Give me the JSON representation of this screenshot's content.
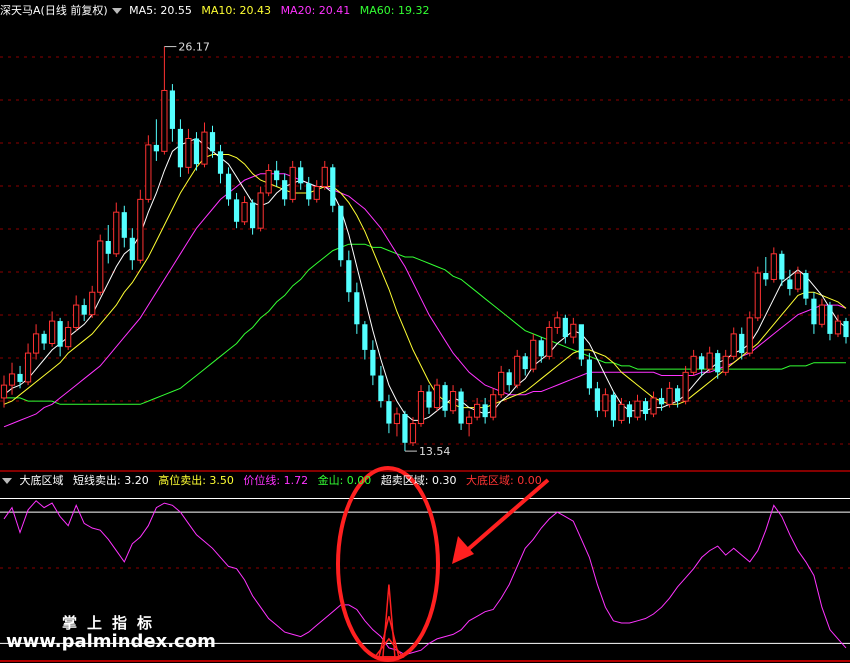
{
  "header": {
    "security": "深天马A",
    "period": "(日线 前复权)",
    "ma": [
      {
        "label": "MA5: 20.55",
        "color": "#ffffff"
      },
      {
        "label": "MA10: 20.43",
        "color": "#ffff33"
      },
      {
        "label": "MA20: 20.41",
        "color": "#ff33ff"
      },
      {
        "label": "MA60: 19.32",
        "color": "#33ff33"
      }
    ]
  },
  "indicator": {
    "name": "大底区域",
    "items": [
      {
        "label": "短线卖出: 3.20",
        "color": "#ffffff"
      },
      {
        "label": "高位卖出: 3.50",
        "color": "#ffff33"
      },
      {
        "label": "价位线: 1.72",
        "color": "#ff33ff"
      },
      {
        "label": "金山: 0.00",
        "color": "#33ff33"
      },
      {
        "label": "超卖区域: 0.30",
        "color": "#ffffff"
      },
      {
        "label": "大底区域: 0.00",
        "color": "#ff3333"
      }
    ]
  },
  "annotations": {
    "high": "26.17",
    "low": "13.54"
  },
  "watermark": {
    "line1": "掌上指标",
    "line2": "www.palmindex.com"
  },
  "colors": {
    "up": "#ff3232",
    "down": "#54ffff",
    "ma5": "#ffffff",
    "ma10": "#ffff33",
    "ma20": "#ff33ff",
    "ma60": "#33ff33",
    "grid": "#8b0000",
    "indicator": "#ff33ff",
    "spike": "#ff2020",
    "circle": "#ff2020"
  },
  "chart_data": {
    "type": "candlestick",
    "price_range": [
      13.2,
      27.0
    ],
    "candles": [
      [
        15.2,
        15.9,
        14.9,
        15.6
      ],
      [
        15.6,
        16.3,
        15.3,
        15.95
      ],
      [
        15.95,
        16.2,
        15.5,
        15.7
      ],
      [
        15.7,
        16.9,
        15.6,
        16.6
      ],
      [
        16.6,
        17.5,
        16.4,
        17.2
      ],
      [
        17.2,
        17.3,
        16.7,
        16.9
      ],
      [
        16.9,
        17.9,
        16.8,
        17.6
      ],
      [
        17.6,
        17.7,
        16.5,
        16.8
      ],
      [
        16.8,
        17.6,
        16.7,
        17.4
      ],
      [
        17.4,
        18.4,
        17.3,
        18.1
      ],
      [
        18.1,
        18.3,
        17.6,
        17.8
      ],
      [
        17.8,
        18.7,
        17.7,
        18.5
      ],
      [
        18.5,
        20.3,
        18.4,
        20.1
      ],
      [
        20.1,
        20.6,
        19.4,
        19.7
      ],
      [
        19.7,
        21.3,
        19.6,
        21.0
      ],
      [
        21.0,
        21.2,
        19.9,
        20.2
      ],
      [
        20.2,
        20.5,
        19.2,
        19.5
      ],
      [
        19.5,
        21.7,
        19.4,
        21.4
      ],
      [
        21.4,
        23.4,
        21.3,
        23.1
      ],
      [
        23.1,
        23.9,
        22.6,
        22.9
      ],
      [
        22.9,
        26.17,
        22.8,
        24.8
      ],
      [
        24.8,
        25.0,
        23.2,
        23.6
      ],
      [
        23.6,
        23.9,
        22.1,
        22.4
      ],
      [
        22.4,
        23.6,
        22.2,
        23.3
      ],
      [
        23.3,
        23.5,
        22.3,
        22.5
      ],
      [
        22.5,
        23.8,
        22.4,
        23.5
      ],
      [
        23.5,
        23.7,
        22.7,
        22.9
      ],
      [
        22.9,
        23.1,
        21.9,
        22.2
      ],
      [
        22.2,
        22.4,
        21.2,
        21.4
      ],
      [
        21.4,
        21.6,
        20.5,
        20.7
      ],
      [
        20.7,
        21.5,
        20.6,
        21.3
      ],
      [
        21.3,
        21.4,
        20.3,
        20.5
      ],
      [
        20.5,
        21.8,
        20.4,
        21.6
      ],
      [
        21.6,
        22.5,
        21.5,
        22.3
      ],
      [
        22.3,
        22.6,
        21.8,
        22.0
      ],
      [
        22.0,
        22.2,
        21.2,
        21.4
      ],
      [
        21.4,
        22.6,
        21.3,
        22.4
      ],
      [
        22.4,
        22.6,
        21.7,
        21.9
      ],
      [
        21.9,
        22.1,
        21.2,
        21.4
      ],
      [
        21.4,
        22.0,
        21.3,
        21.8
      ],
      [
        21.8,
        22.6,
        21.7,
        22.4
      ],
      [
        22.4,
        22.5,
        21.0,
        21.2
      ],
      [
        21.2,
        20.8,
        19.3,
        19.5
      ],
      [
        19.5,
        19.8,
        18.2,
        18.5
      ],
      [
        18.5,
        18.8,
        17.2,
        17.5
      ],
      [
        17.5,
        17.6,
        16.4,
        16.7
      ],
      [
        16.7,
        17.0,
        15.6,
        15.9
      ],
      [
        15.9,
        16.2,
        14.9,
        15.1
      ],
      [
        15.1,
        15.3,
        14.1,
        14.4
      ],
      [
        14.4,
        14.9,
        14.0,
        14.7
      ],
      [
        14.7,
        14.8,
        13.54,
        13.8
      ],
      [
        13.8,
        14.6,
        13.7,
        14.4
      ],
      [
        14.4,
        15.6,
        14.3,
        15.4
      ],
      [
        15.4,
        15.6,
        14.7,
        14.9
      ],
      [
        14.9,
        15.8,
        14.8,
        15.6
      ],
      [
        15.6,
        15.7,
        14.6,
        14.8
      ],
      [
        14.8,
        15.6,
        14.7,
        15.4
      ],
      [
        15.4,
        15.5,
        14.2,
        14.4
      ],
      [
        14.4,
        14.8,
        14.0,
        14.6
      ],
      [
        14.6,
        15.2,
        14.5,
        15.0
      ],
      [
        15.0,
        15.2,
        14.4,
        14.6
      ],
      [
        14.6,
        15.5,
        14.5,
        15.3
      ],
      [
        15.3,
        16.2,
        15.2,
        16.0
      ],
      [
        16.0,
        16.1,
        15.4,
        15.6
      ],
      [
        15.6,
        16.7,
        15.5,
        16.5
      ],
      [
        16.5,
        16.6,
        15.9,
        16.1
      ],
      [
        16.1,
        17.2,
        16.0,
        17.0
      ],
      [
        17.0,
        17.1,
        16.3,
        16.5
      ],
      [
        16.5,
        17.6,
        16.4,
        17.4
      ],
      [
        17.4,
        17.9,
        17.2,
        17.7
      ],
      [
        17.7,
        17.8,
        16.9,
        17.1
      ],
      [
        17.1,
        17.7,
        16.9,
        17.5
      ],
      [
        17.5,
        17.2,
        16.2,
        16.4
      ],
      [
        16.4,
        16.6,
        15.3,
        15.5
      ],
      [
        15.5,
        15.7,
        14.6,
        14.8
      ],
      [
        14.8,
        15.5,
        14.6,
        15.3
      ],
      [
        15.3,
        15.4,
        14.3,
        14.5
      ],
      [
        14.5,
        15.2,
        14.4,
        15.0
      ],
      [
        15.0,
        15.1,
        14.4,
        14.6
      ],
      [
        14.6,
        15.3,
        14.5,
        15.1
      ],
      [
        15.1,
        15.2,
        14.5,
        14.7
      ],
      [
        14.7,
        15.4,
        14.6,
        15.2
      ],
      [
        15.2,
        15.5,
        14.8,
        15.0
      ],
      [
        15.0,
        15.7,
        14.9,
        15.5
      ],
      [
        15.5,
        15.6,
        14.9,
        15.1
      ],
      [
        15.1,
        16.2,
        15.0,
        16.0
      ],
      [
        16.0,
        16.7,
        15.9,
        16.5
      ],
      [
        16.5,
        16.6,
        15.9,
        16.1
      ],
      [
        16.1,
        16.8,
        16.0,
        16.6
      ],
      [
        16.6,
        16.7,
        15.8,
        16.0
      ],
      [
        16.0,
        16.7,
        15.9,
        16.5
      ],
      [
        16.5,
        17.4,
        16.4,
        17.2
      ],
      [
        17.2,
        17.4,
        16.4,
        16.6
      ],
      [
        16.6,
        17.9,
        16.5,
        17.7
      ],
      [
        17.7,
        19.3,
        17.6,
        19.1
      ],
      [
        19.1,
        19.6,
        18.7,
        18.9
      ],
      [
        18.9,
        19.9,
        18.8,
        19.7
      ],
      [
        19.7,
        19.8,
        18.7,
        18.9
      ],
      [
        18.9,
        19.2,
        18.4,
        18.6
      ],
      [
        18.6,
        19.3,
        18.5,
        19.1
      ],
      [
        19.1,
        19.2,
        18.1,
        18.3
      ],
      [
        18.3,
        18.5,
        17.2,
        17.5
      ],
      [
        17.5,
        18.3,
        17.4,
        18.1
      ],
      [
        18.1,
        18.2,
        17.0,
        17.2
      ],
      [
        17.2,
        17.8,
        17.1,
        17.6
      ],
      [
        17.6,
        17.7,
        16.9,
        17.1
      ]
    ],
    "ma5": [
      15.3,
      15.5,
      15.6,
      15.8,
      16.1,
      16.4,
      16.7,
      16.9,
      17.1,
      17.3,
      17.5,
      17.8,
      18.3,
      18.8,
      19.3,
      19.7,
      19.9,
      20.3,
      21.0,
      21.6,
      22.3,
      22.9,
      23.1,
      23.2,
      23.3,
      23.1,
      22.9,
      22.7,
      22.5,
      22.1,
      21.7,
      21.3,
      21.2,
      21.3,
      21.6,
      21.8,
      21.9,
      22.0,
      21.9,
      21.8,
      21.8,
      21.6,
      21.1,
      20.3,
      19.3,
      18.3,
      17.3,
      16.4,
      15.6,
      15.1,
      14.7,
      14.5,
      14.5,
      14.6,
      14.8,
      15.0,
      15.2,
      15.1,
      14.9,
      14.8,
      14.7,
      14.8,
      15.1,
      15.3,
      15.6,
      15.8,
      16.2,
      16.4,
      16.6,
      16.9,
      17.1,
      17.3,
      17.2,
      16.9,
      16.4,
      15.9,
      15.4,
      15.0,
      14.8,
      14.8,
      14.8,
      14.9,
      14.9,
      15.0,
      15.1,
      15.3,
      15.6,
      15.9,
      16.1,
      16.3,
      16.4,
      16.6,
      16.7,
      16.9,
      17.3,
      17.8,
      18.3,
      18.8,
      19.0,
      19.2,
      19.0,
      18.7,
      18.4,
      18.0,
      17.6,
      17.4
    ],
    "ma10": [
      15.0,
      15.1,
      15.3,
      15.5,
      15.7,
      15.9,
      16.1,
      16.3,
      16.6,
      16.8,
      17.0,
      17.2,
      17.5,
      17.8,
      18.1,
      18.5,
      18.8,
      19.2,
      19.6,
      20.1,
      20.6,
      21.1,
      21.6,
      22.0,
      22.4,
      22.7,
      22.8,
      22.8,
      22.8,
      22.7,
      22.5,
      22.2,
      22.0,
      21.9,
      21.8,
      21.7,
      21.6,
      21.6,
      21.6,
      21.7,
      21.8,
      21.8,
      21.6,
      21.3,
      20.9,
      20.4,
      19.8,
      19.2,
      18.6,
      17.9,
      17.3,
      16.7,
      16.2,
      15.7,
      15.3,
      15.1,
      15.0,
      14.9,
      14.9,
      14.9,
      14.9,
      15.0,
      15.1,
      15.2,
      15.3,
      15.4,
      15.6,
      15.8,
      16.0,
      16.2,
      16.4,
      16.6,
      16.7,
      16.7,
      16.6,
      16.5,
      16.3,
      16.0,
      15.8,
      15.6,
      15.4,
      15.2,
      15.1,
      15.0,
      15.0,
      15.1,
      15.3,
      15.5,
      15.7,
      15.9,
      16.1,
      16.3,
      16.5,
      16.7,
      16.9,
      17.2,
      17.5,
      17.8,
      18.1,
      18.4,
      18.5,
      18.5,
      18.4,
      18.3,
      18.2,
      18.0
    ],
    "ma20": [
      14.3,
      14.4,
      14.5,
      14.6,
      14.7,
      14.9,
      15.0,
      15.2,
      15.4,
      15.6,
      15.8,
      16.0,
      16.2,
      16.5,
      16.8,
      17.1,
      17.4,
      17.7,
      18.1,
      18.5,
      18.9,
      19.3,
      19.7,
      20.1,
      20.5,
      20.8,
      21.1,
      21.4,
      21.6,
      21.8,
      22.0,
      22.1,
      22.2,
      22.2,
      22.2,
      22.2,
      22.1,
      22.0,
      21.9,
      21.8,
      21.8,
      21.7,
      21.6,
      21.5,
      21.3,
      21.1,
      20.8,
      20.5,
      20.1,
      19.7,
      19.3,
      18.8,
      18.3,
      17.8,
      17.4,
      17.0,
      16.6,
      16.3,
      16.0,
      15.8,
      15.6,
      15.5,
      15.4,
      15.3,
      15.3,
      15.3,
      15.4,
      15.4,
      15.5,
      15.6,
      15.7,
      15.8,
      15.9,
      16.0,
      16.0,
      16.0,
      16.0,
      16.0,
      16.0,
      16.0,
      16.0,
      16.0,
      15.9,
      15.9,
      15.9,
      15.9,
      15.9,
      16.0,
      16.0,
      16.1,
      16.2,
      16.3,
      16.5,
      16.6,
      16.8,
      17.0,
      17.2,
      17.4,
      17.6,
      17.8,
      17.9,
      18.0,
      18.1,
      18.1,
      18.1,
      18.0
    ],
    "ma60": [
      15.2,
      15.2,
      15.2,
      15.1,
      15.1,
      15.1,
      15.1,
      15.0,
      15.0,
      15.0,
      15.0,
      15.0,
      15.0,
      15.0,
      15.0,
      15.0,
      15.0,
      15.0,
      15.1,
      15.2,
      15.3,
      15.4,
      15.5,
      15.7,
      15.9,
      16.1,
      16.3,
      16.5,
      16.7,
      16.9,
      17.2,
      17.4,
      17.7,
      17.9,
      18.2,
      18.4,
      18.7,
      18.9,
      19.2,
      19.4,
      19.6,
      19.8,
      19.9,
      20.0,
      20.0,
      20.0,
      19.9,
      19.9,
      19.8,
      19.7,
      19.6,
      19.6,
      19.5,
      19.4,
      19.3,
      19.2,
      19.0,
      18.9,
      18.7,
      18.5,
      18.3,
      18.1,
      17.9,
      17.7,
      17.5,
      17.3,
      17.2,
      17.1,
      17.0,
      16.9,
      16.8,
      16.7,
      16.6,
      16.5,
      16.4,
      16.3,
      16.3,
      16.2,
      16.2,
      16.1,
      16.1,
      16.1,
      16.1,
      16.1,
      16.1,
      16.1,
      16.1,
      16.1,
      16.1,
      16.1,
      16.1,
      16.1,
      16.1,
      16.1,
      16.1,
      16.1,
      16.1,
      16.1,
      16.2,
      16.2,
      16.2,
      16.3,
      16.3,
      16.3,
      16.3,
      16.3
    ],
    "indicator_range": [
      0.0,
      3.6
    ],
    "indicator_levels": [
      {
        "name": "高位卖出",
        "value": 3.5
      },
      {
        "name": "短线卖出",
        "value": 3.2
      },
      {
        "name": "超卖区域",
        "value": 0.3
      },
      {
        "name": "金山",
        "value": 0.0
      }
    ],
    "indicator": [
      3.05,
      3.3,
      2.75,
      3.25,
      3.45,
      3.3,
      3.4,
      3.1,
      2.9,
      3.35,
      2.95,
      2.85,
      2.8,
      2.6,
      2.35,
      2.1,
      2.5,
      2.65,
      2.9,
      3.3,
      3.4,
      3.35,
      3.2,
      2.95,
      2.7,
      2.55,
      2.4,
      2.2,
      2.0,
      1.95,
      1.7,
      1.35,
      1.1,
      0.85,
      0.7,
      0.55,
      0.5,
      0.45,
      0.55,
      0.7,
      0.85,
      1.0,
      1.15,
      1.15,
      1.05,
      0.8,
      0.6,
      0.45,
      0.2,
      0.15,
      0.05,
      0.1,
      0.15,
      0.3,
      0.4,
      0.45,
      0.5,
      0.6,
      0.8,
      0.9,
      1.0,
      1.05,
      1.3,
      1.6,
      2.0,
      2.4,
      2.6,
      2.85,
      3.05,
      3.2,
      3.1,
      3.0,
      2.6,
      2.2,
      1.6,
      1.1,
      0.8,
      0.75,
      0.75,
      0.8,
      0.85,
      0.95,
      1.1,
      1.3,
      1.55,
      1.75,
      1.95,
      2.2,
      2.35,
      2.45,
      2.25,
      2.4,
      2.25,
      2.1,
      2.35,
      2.8,
      3.35,
      3.1,
      2.7,
      2.35,
      2.1,
      1.8,
      1.1,
      0.6,
      0.4,
      0.2
    ],
    "spike": {
      "index": 48,
      "value": 1.6,
      "levels": [
        0.9,
        0.4
      ]
    }
  }
}
